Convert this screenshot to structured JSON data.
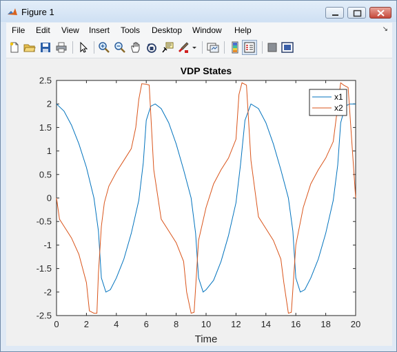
{
  "window": {
    "title": "Figure 1"
  },
  "menu": [
    "File",
    "Edit",
    "View",
    "Insert",
    "Tools",
    "Desktop",
    "Window",
    "Help"
  ],
  "menu_arrow": "↘",
  "toolbar_icons": [
    "new-figure-icon",
    "open-file-icon",
    "save-icon",
    "print-icon",
    "edit-plot-arrow-icon",
    "zoom-in-icon",
    "zoom-out-icon",
    "pan-hand-icon",
    "rotate-3d-icon",
    "data-cursor-icon",
    "brush-icon",
    "brush-dropdown-icon",
    "link-plot-icon",
    "insert-colorbar-icon",
    "insert-legend-icon",
    "hide-plot-tools-icon",
    "show-plot-tools-icon"
  ],
  "colors": {
    "x1": "#0072bd",
    "x2": "#d95319"
  },
  "chart_data": {
    "type": "line",
    "title": "VDP States",
    "xlabel": "Time",
    "ylabel": "",
    "xlim": [
      0,
      20
    ],
    "ylim": [
      -2.5,
      2.5
    ],
    "xticks": [
      0,
      2,
      4,
      6,
      8,
      10,
      12,
      14,
      16,
      18,
      20
    ],
    "yticks": [
      -2.5,
      -2,
      -1.5,
      -1,
      -0.5,
      0,
      0.5,
      1,
      1.5,
      2,
      2.5
    ],
    "grid": false,
    "legend_position": "top-right",
    "series": [
      {
        "name": "x1",
        "x": [
          0,
          0.5,
          1,
          1.5,
          2,
          2.5,
          2.8,
          3,
          3.3,
          3.6,
          4,
          4.5,
          5,
          5.5,
          5.8,
          6,
          6.3,
          6.6,
          7,
          7.5,
          8,
          8.5,
          9,
          9.3,
          9.5,
          9.8,
          10,
          10.5,
          11,
          11.5,
          12,
          12.3,
          12.6,
          13,
          13.5,
          14,
          14.5,
          15,
          15.5,
          15.8,
          16,
          16.3,
          16.6,
          17,
          17.5,
          18,
          18.5,
          18.8,
          19,
          19.3,
          19.6,
          20
        ],
        "values": [
          2,
          1.85,
          1.55,
          1.15,
          0.65,
          0,
          -0.7,
          -1.7,
          -2,
          -1.95,
          -1.7,
          -1.3,
          -0.75,
          -0.05,
          0.75,
          1.65,
          1.95,
          2,
          1.9,
          1.6,
          1.15,
          0.6,
          0,
          -0.75,
          -1.7,
          -2,
          -1.95,
          -1.75,
          -1.35,
          -0.8,
          -0.1,
          0.7,
          1.65,
          2,
          1.9,
          1.6,
          1.15,
          0.6,
          0,
          -0.7,
          -1.7,
          -2,
          -1.95,
          -1.7,
          -1.3,
          -0.75,
          -0.05,
          0.7,
          1.6,
          1.95,
          2,
          2
        ]
      },
      {
        "name": "x2",
        "x": [
          0,
          0.2,
          0.5,
          1,
          1.5,
          2,
          2.2,
          2.5,
          2.7,
          2.8,
          3,
          3.2,
          3.5,
          4,
          4.5,
          5,
          5.3,
          5.5,
          5.7,
          6,
          6.2,
          6.5,
          7,
          7.5,
          8,
          8.5,
          8.7,
          9,
          9.2,
          9.5,
          10,
          10.5,
          11,
          11.5,
          12,
          12.2,
          12.4,
          12.7,
          13,
          13.5,
          14,
          14.5,
          15,
          15.2,
          15.5,
          15.7,
          16,
          16.5,
          17,
          17.5,
          18,
          18.5,
          18.8,
          19,
          19.2,
          19.5,
          20
        ],
        "values": [
          0,
          -0.45,
          -0.6,
          -0.85,
          -1.2,
          -1.8,
          -2.4,
          -2.45,
          -2.45,
          -1.6,
          -0.6,
          -0.1,
          0.25,
          0.55,
          0.8,
          1.05,
          1.5,
          2.1,
          2.43,
          2.42,
          2.4,
          0.6,
          -0.45,
          -0.7,
          -0.95,
          -1.35,
          -2.0,
          -2.45,
          -2.43,
          -0.9,
          -0.2,
          0.3,
          0.6,
          0.85,
          1.25,
          2.2,
          2.45,
          2.4,
          0.8,
          -0.4,
          -0.65,
          -0.9,
          -1.3,
          -1.8,
          -2.45,
          -2.43,
          -1.0,
          -0.2,
          0.3,
          0.6,
          0.85,
          1.2,
          1.95,
          2.45,
          2.4,
          2.35,
          0
        ]
      }
    ]
  }
}
